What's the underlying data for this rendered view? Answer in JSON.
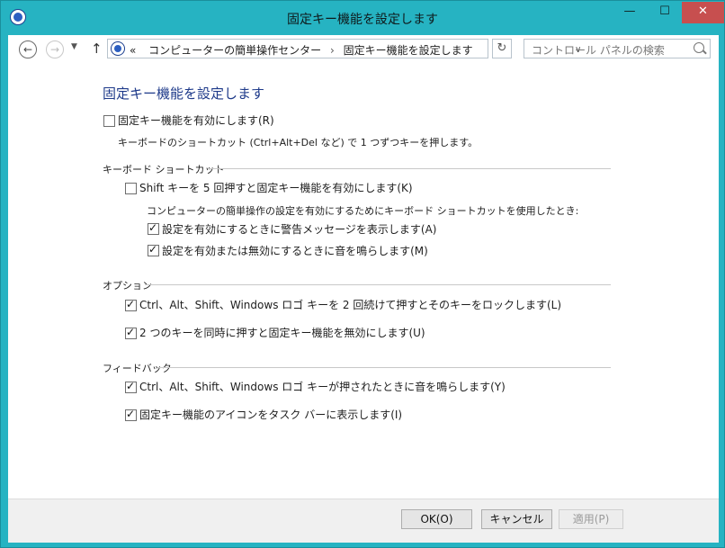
{
  "window": {
    "title": "固定キー機能を設定します",
    "min": "—",
    "max": "☐",
    "close": "✕"
  },
  "address": {
    "prefix": "«",
    "crumb1": "コンピューターの簡単操作センター",
    "sep": "›",
    "crumb2": "固定キー機能を設定します",
    "search_placeholder": "コントロール パネルの検索"
  },
  "page": {
    "heading": "固定キー機能を設定します",
    "enable_label": "固定キー機能を有効にします(R)",
    "enable_checked": false,
    "enable_desc": "キーボードのショートカット (Ctrl+Alt+Del など) で 1 つずつキーを押します。"
  },
  "shortcut_group": {
    "title": "キーボード ショートカット",
    "shift5_label": "Shift キーを 5 回押すと固定キー機能を有効にします(K)",
    "shift5_checked": false,
    "sub_desc": "コンピューターの簡単操作の設定を有効にするためにキーボード ショートカットを使用したとき:",
    "warn_label": "設定を有効にするときに警告メッセージを表示します(A)",
    "warn_checked": true,
    "sound_label": "設定を有効または無効にするときに音を鳴らします(M)",
    "sound_checked": true
  },
  "options_group": {
    "title": "オプション",
    "lock_label": "Ctrl、Alt、Shift、Windows ロゴ キーを 2 回続けて押すとそのキーをロックします(L)",
    "lock_checked": true,
    "twokeys_label": "2 つのキーを同時に押すと固定キー機能を無効にします(U)",
    "twokeys_checked": true
  },
  "feedback_group": {
    "title": "フィードバック",
    "beep_label": "Ctrl、Alt、Shift、Windows ロゴ キーが押されたときに音を鳴らします(Y)",
    "beep_checked": true,
    "tray_label": "固定キー機能のアイコンをタスク バーに表示します(I)",
    "tray_checked": true
  },
  "footer": {
    "ok": "OK(O)",
    "cancel": "キャンセル",
    "apply": "適用(P)"
  }
}
